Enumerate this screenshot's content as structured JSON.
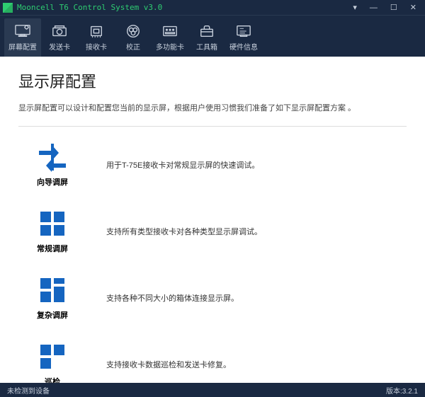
{
  "titlebar": {
    "title": "Mooncell T6 Control System v3.0"
  },
  "toolbar": {
    "items": [
      {
        "label": "屏幕配置",
        "icon": "screen-config"
      },
      {
        "label": "发送卡",
        "icon": "send-card"
      },
      {
        "label": "接收卡",
        "icon": "receive-card"
      },
      {
        "label": "校正",
        "icon": "calibrate"
      },
      {
        "label": "多功能卡",
        "icon": "multi-card"
      },
      {
        "label": "工具箱",
        "icon": "toolbox"
      },
      {
        "label": "硬件信息",
        "icon": "hardware-info"
      }
    ]
  },
  "page": {
    "title": "显示屏配置",
    "desc": "显示屏配置可以设计和配置您当前的显示屏，根据用户使用习惯我们准备了如下显示屏配置方案 。"
  },
  "options": [
    {
      "label": "向导调屏",
      "desc": "用于T-75E接收卡对常规显示屏的快速调试。",
      "icon": "wizard"
    },
    {
      "label": "常规调屏",
      "desc": "支持所有类型接收卡对各种类型显示屏调试。",
      "icon": "grid"
    },
    {
      "label": "复杂调屏",
      "desc": "支持各种不同大小的箱体连接显示屏。",
      "icon": "complex"
    },
    {
      "label": "巡检",
      "desc": "支持接收卡数据巡检和发送卡修复。",
      "icon": "inspect"
    }
  ],
  "statusbar": {
    "left": "未检测到设备",
    "right": "版本:3.2.1"
  }
}
